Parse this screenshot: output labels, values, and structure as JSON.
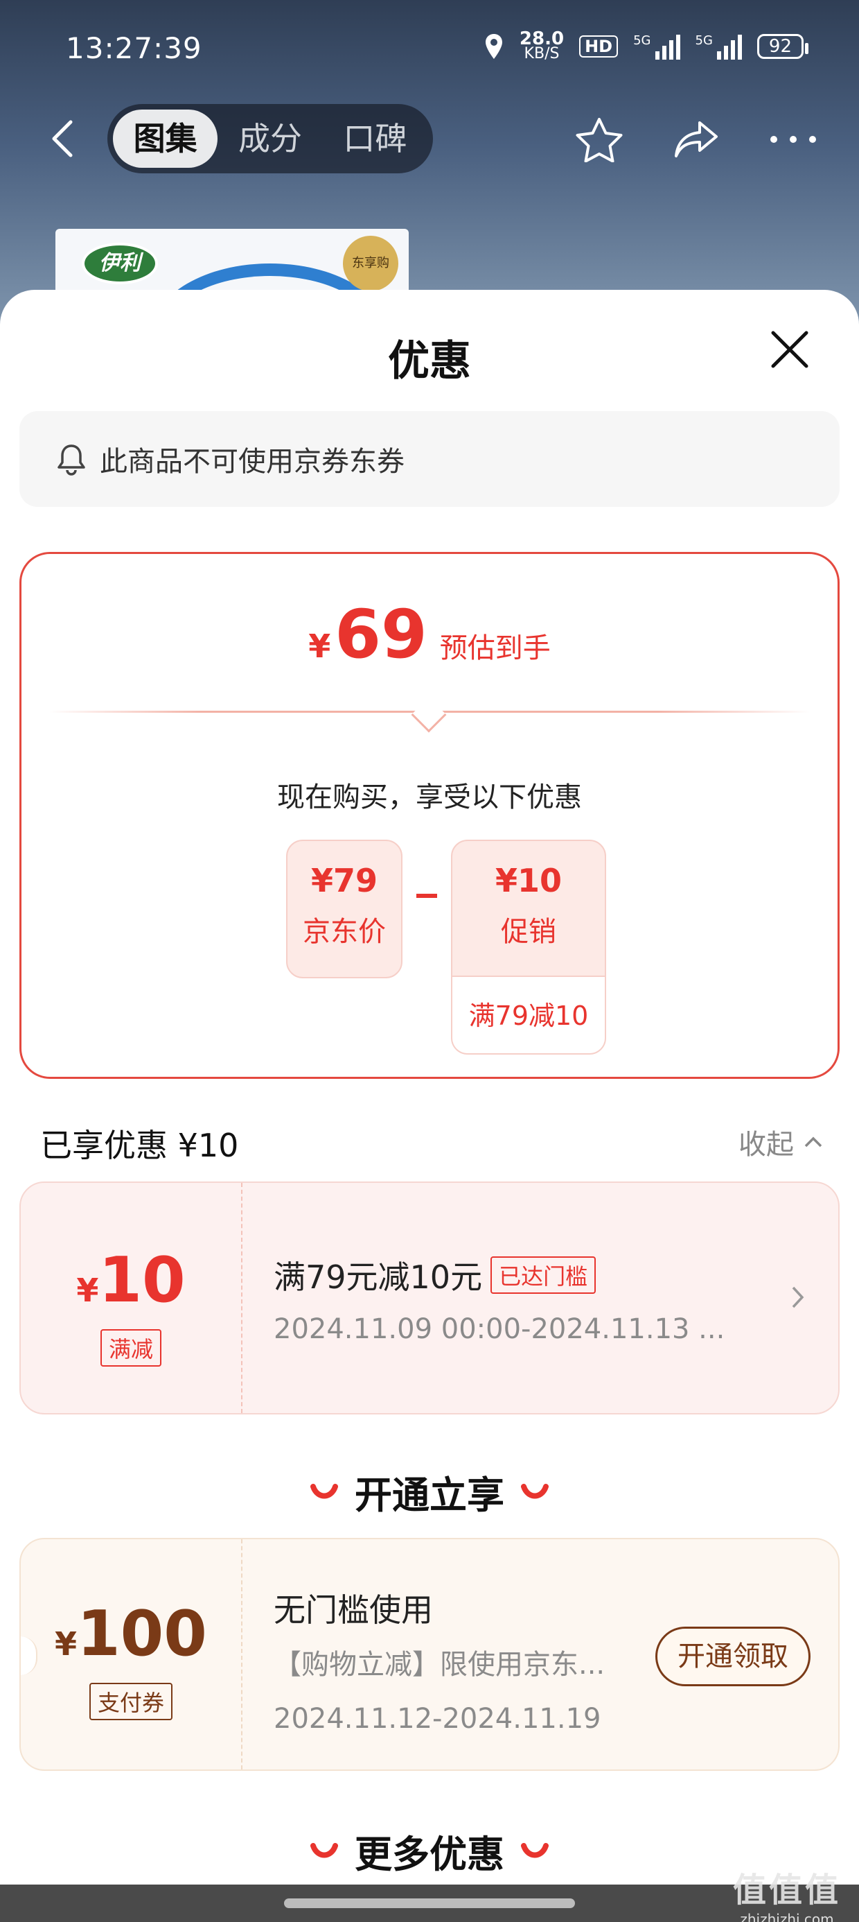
{
  "status_bar": {
    "time": "13:27:39",
    "net_speed": "28.0",
    "net_unit": "KB/S",
    "hd_label": "HD",
    "signal1_label": "5G",
    "signal2_label": "5G",
    "battery": "92"
  },
  "nav": {
    "tabs": [
      {
        "label": "图集",
        "active": true
      },
      {
        "label": "成分",
        "active": false
      },
      {
        "label": "口碑",
        "active": false
      }
    ]
  },
  "product": {
    "brand": "伊利",
    "seal": "东享购"
  },
  "sheet": {
    "title": "优惠",
    "notice": "此商品不可使用京券东券"
  },
  "estimate": {
    "currency": "¥",
    "price": "69",
    "label": "预估到手",
    "subtitle": "现在购买，享受以下优惠",
    "jd_price": {
      "value": "¥79",
      "name": "京东价"
    },
    "promo": {
      "value": "¥10",
      "name": "促销",
      "detail": "满79减10"
    }
  },
  "enjoyed": {
    "text": "已享优惠 ¥10",
    "collapse": "收起"
  },
  "coupon1": {
    "currency": "¥",
    "amount": "10",
    "tag": "满减",
    "title": "满79元减10元",
    "badge": "已达门槛",
    "period": "2024.11.09 00:00-2024.11.13 ..."
  },
  "section_open": "开通立享",
  "coupon2": {
    "currency": "¥",
    "amount": "100",
    "tag": "支付券",
    "title": "无门槛使用",
    "desc": "【购物立减】限使用京东...",
    "period": "2024.11.12-2024.11.19",
    "button": "开通领取"
  },
  "section_more": "更多优惠",
  "watermark": {
    "line1": "值值值",
    "line2": "zhizhizhi.com"
  },
  "colors": {
    "accent_red": "#e8342e",
    "coupon_brown": "#7a3a17"
  }
}
